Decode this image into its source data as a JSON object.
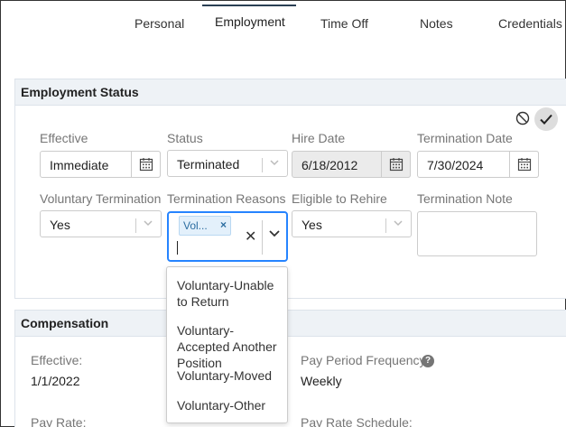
{
  "tabs": [
    {
      "label": "Personal"
    },
    {
      "label": "Employment"
    },
    {
      "label": "Time Off"
    },
    {
      "label": "Notes"
    },
    {
      "label": "Credentials"
    }
  ],
  "employment_status": {
    "title": "Employment Status",
    "effective": {
      "label": "Effective",
      "value": "Immediate"
    },
    "status": {
      "label": "Status",
      "value": "Terminated"
    },
    "hire_date": {
      "label": "Hire Date",
      "value": "6/18/2012"
    },
    "termination_date": {
      "label": "Termination Date",
      "value": "7/30/2024"
    },
    "voluntary_termination": {
      "label": "Voluntary Termination",
      "value": "Yes"
    },
    "termination_reasons": {
      "label": "Termination Reasons",
      "chip": "Vol...",
      "options": [
        "Voluntary-Unable to Return",
        "Voluntary-Accepted Another Position",
        "Voluntary-Moved",
        "Voluntary-Other"
      ]
    },
    "eligible_to_rehire": {
      "label": "Eligible to Rehire",
      "value": "Yes"
    },
    "termination_note": {
      "label": "Termination Note",
      "value": ""
    }
  },
  "compensation": {
    "title": "Compensation",
    "effective": {
      "label": "Effective:",
      "value": "1/1/2022"
    },
    "pay_period_frequency": {
      "label": "Pay Period Frequency:",
      "value": "Weekly"
    },
    "pay_rate": {
      "label": "Pay Rate:"
    },
    "pay_rate_schedule": {
      "label": "Pay Rate Schedule:"
    }
  },
  "colors": {
    "accent": "#2684ff",
    "section_bg": "#eef2f6",
    "active_tab": "#2a3f54"
  },
  "icons": [
    "cancel-icon",
    "check-icon",
    "calendar-icon",
    "chevron-down-icon",
    "close-icon",
    "help-icon"
  ]
}
